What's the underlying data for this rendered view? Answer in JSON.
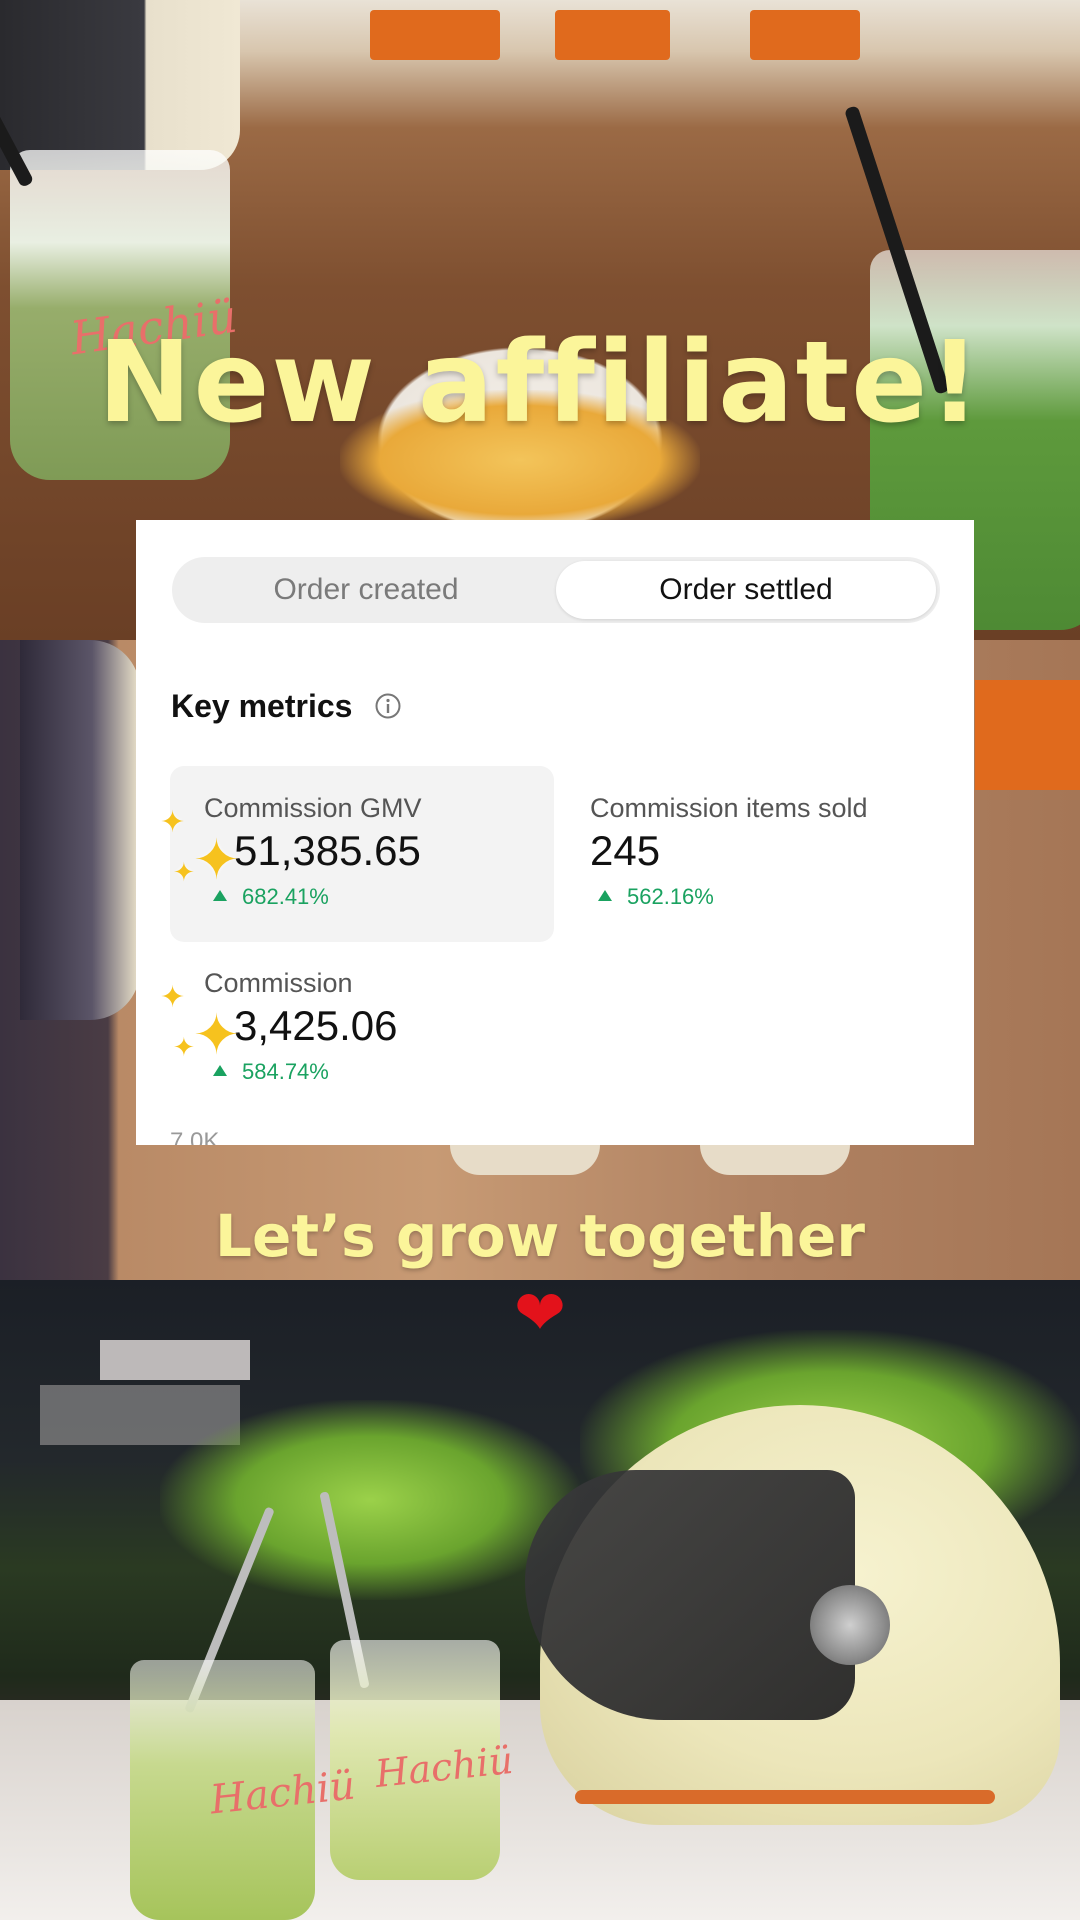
{
  "headline": "New affiliate!",
  "tagline": "Let’s grow together",
  "heart": "❤",
  "cup_brand": "Hachiü",
  "metrics_card": {
    "tabs": [
      {
        "label": "Order created",
        "selected": false
      },
      {
        "label": "Order settled",
        "selected": true
      }
    ],
    "section_title": "Key metrics",
    "metrics": [
      {
        "label": "Commission GMV",
        "value": "51,385.65",
        "change": "682.41%"
      },
      {
        "label": "Commission items sold",
        "value": "245",
        "change": "562.16%"
      },
      {
        "label": "Commission",
        "value": "3,425.06",
        "change": "584.74%"
      }
    ],
    "cut_off_text": "7.0K"
  },
  "colors": {
    "headline": "#fbf59a",
    "positive_change": "#1aa260",
    "heart": "#e3121b",
    "sparkle": "#f6c21e"
  },
  "icons": [
    "info-icon",
    "up-arrow-icon",
    "sparkle-icon",
    "heart-icon"
  ]
}
